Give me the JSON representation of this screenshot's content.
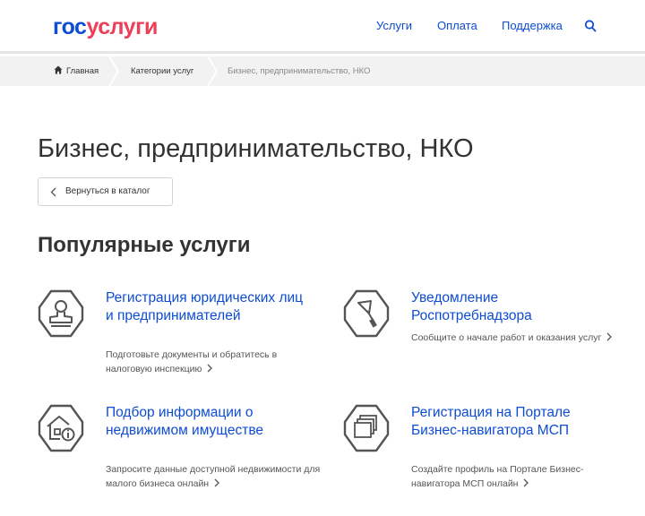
{
  "header": {
    "logo_part1": "гос",
    "logo_part2": "услуги",
    "nav": [
      "Услуги",
      "Оплата",
      "Поддержка"
    ],
    "search_icon": "search-icon"
  },
  "breadcrumbs": [
    "Главная",
    "Категории услуг",
    "Бизнес, предпринимательство, НКО"
  ],
  "page": {
    "title": "Бизнес, предпринимательство, НКО",
    "back_label": "Вернуться в каталог",
    "section_title": "Популярные услуги"
  },
  "services": [
    {
      "title": "Регистрация юридических лиц и предпринимателей",
      "description": "Подготовьте документы и обратитесь в налоговую инспекцию",
      "icon": "stamp-icon"
    },
    {
      "title": "Уведомление Роспотребнадзора",
      "description": "Сообщите о начале работ и оказания услуг",
      "icon": "trowel-icon"
    },
    {
      "title": "Подбор информации о недвижимом имуществе",
      "description": "Запросите данные доступной недвижимости для малого бизнеса онлайн",
      "icon": "house-info-icon"
    },
    {
      "title": "Регистрация на Портале Бизнес-навигатора МСП",
      "description": "Создайте профиль на Портале Бизнес-навигатора МСП онлайн",
      "icon": "layers-icon"
    }
  ],
  "colors": {
    "link": "#0d4cd3",
    "logo_red": "#ee3f58",
    "breadcrumb_bg": "#f2f2f2",
    "icon_stroke": "#555555"
  }
}
